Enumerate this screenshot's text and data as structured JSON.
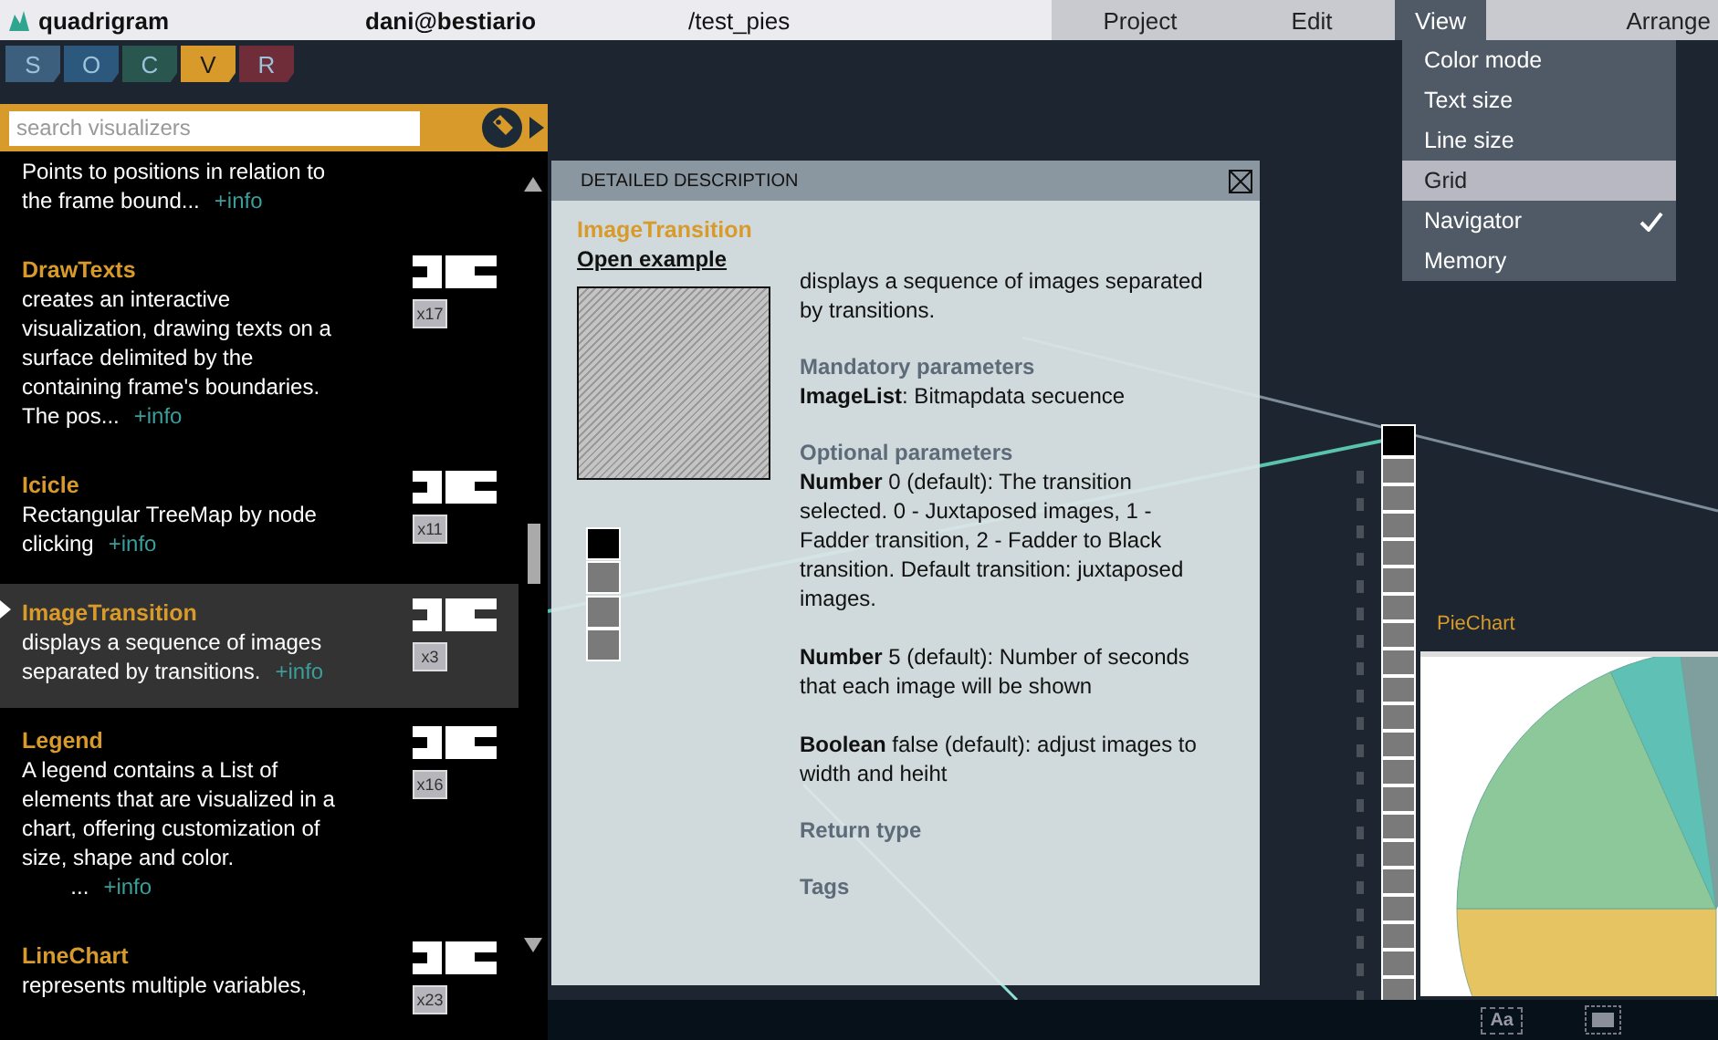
{
  "top_bar": {
    "app_name": "quadrigram",
    "user": "dani@bestiario",
    "path": "/test_pies",
    "menus": [
      {
        "label": "Project",
        "selected": false
      },
      {
        "label": "Edit",
        "selected": false
      },
      {
        "label": "View",
        "selected": true
      },
      {
        "label": "Arrange",
        "selected": false
      }
    ]
  },
  "view_menu": {
    "items": [
      {
        "label": "Color mode",
        "highlighted": false,
        "checked": false
      },
      {
        "label": "Text size",
        "highlighted": false,
        "checked": false
      },
      {
        "label": "Line size",
        "highlighted": false,
        "checked": false
      },
      {
        "label": "Grid",
        "highlighted": true,
        "checked": false
      },
      {
        "label": "Navigator",
        "highlighted": false,
        "checked": true
      },
      {
        "label": "Memory",
        "highlighted": false,
        "checked": false
      }
    ]
  },
  "section_tabs": [
    {
      "label": "S",
      "selected": false,
      "color": "#3b5f7c"
    },
    {
      "label": "O",
      "selected": false,
      "color": "#2b587c"
    },
    {
      "label": "C",
      "selected": false,
      "color": "#2a5650"
    },
    {
      "label": "V",
      "selected": true,
      "color": "#d89b2b"
    },
    {
      "label": "R",
      "selected": false,
      "color": "#6e2d38"
    }
  ],
  "visualizer_panel": {
    "search": {
      "placeholder": "search visualizers"
    },
    "items": [
      {
        "lines": [
          "Points to positions in relation to",
          "the frame bound..."
        ],
        "more": "+info",
        "selected": false
      },
      {
        "name": "DrawTexts",
        "lines": [
          "creates an interactive",
          "visualization, drawing texts on a",
          "surface delimited by the",
          "containing frame's boundaries.",
          "The pos..."
        ],
        "more": "+info",
        "count": "x17",
        "selected": false
      },
      {
        "name": "Icicle",
        "lines": [
          "Rectangular TreeMap by node",
          "clicking"
        ],
        "more": "+info",
        "count": "x11",
        "selected": false
      },
      {
        "name": "ImageTransition",
        "lines": [
          "displays a sequence of images",
          "separated by transitions."
        ],
        "more": "+info",
        "count": "x3",
        "selected": true
      },
      {
        "name": "Legend",
        "lines": [
          "A legend contains a List of",
          "elements that are visualized in a",
          "chart, offering customization of",
          "size, shape and color.",
          "        ..."
        ],
        "more": "+info",
        "count": "x16",
        "selected": false
      },
      {
        "name": "LineChart",
        "lines": [
          "represents multiple variables,"
        ],
        "count": "x23",
        "selected": false
      }
    ]
  },
  "detail_panel": {
    "header": "DETAILED DESCRIPTION",
    "title": "ImageTransition",
    "link": "Open example",
    "summary": "displays a sequence of images separated by transitions.",
    "sections": [
      {
        "heading": "Mandatory parameters",
        "params": [
          "**ImageList**: Bitmapdata secuence"
        ]
      },
      {
        "heading": "Optional parameters",
        "params": [
          "**Number** 0 (default): The transition selected. 0 - Juxtaposed images, 1 - Fadder transition, 2 - Fadder to Black transition. Default transition: juxtaposed images.",
          "**Number** 5 (default): Number of seconds that each image will be shown",
          "**Boolean** false (default): adjust images to width and heiht"
        ]
      },
      {
        "heading": "Return type"
      },
      {
        "heading": "Tags"
      }
    ]
  },
  "canvas": {
    "node_label": "PieChart"
  },
  "bottom_bar": {
    "text_tool": "Aa"
  }
}
